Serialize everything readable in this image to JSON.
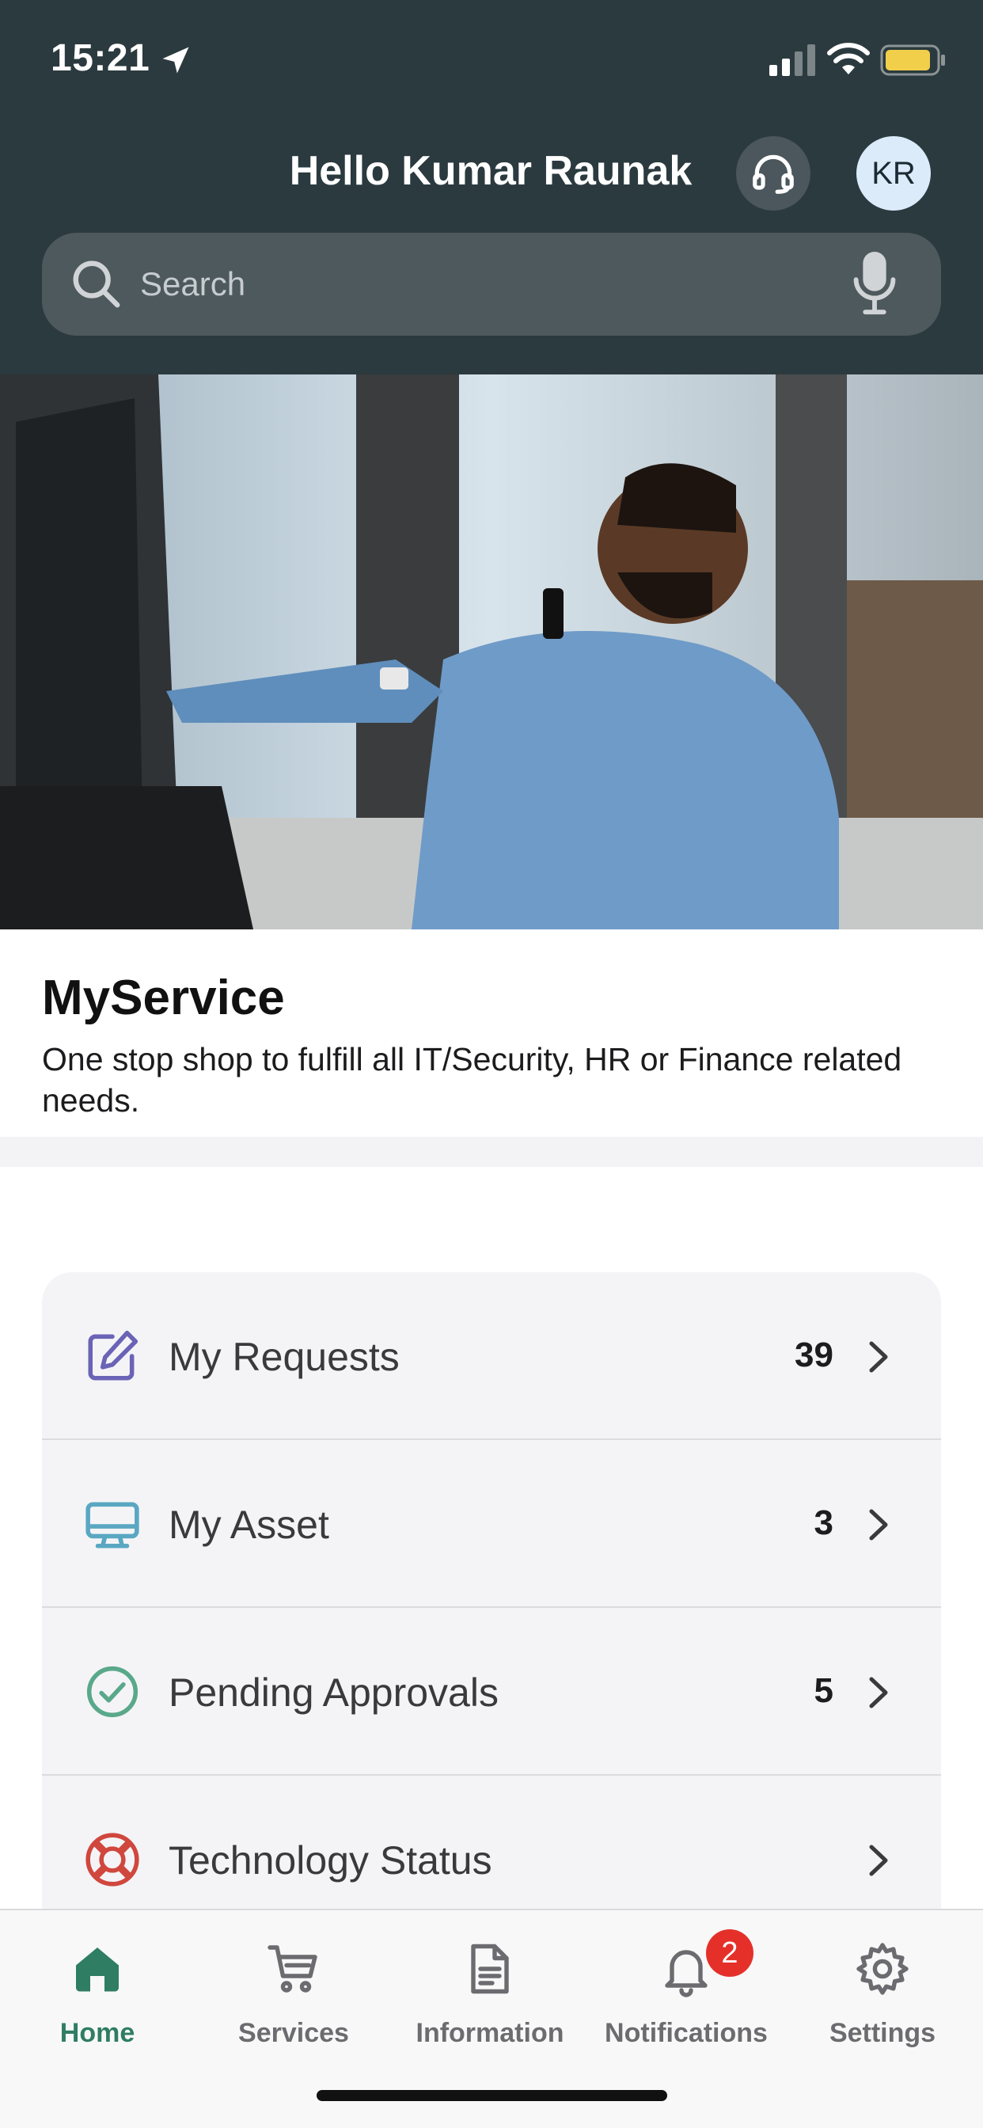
{
  "status_bar": {
    "time": "15:21"
  },
  "header": {
    "greeting": "Hello Kumar Raunak",
    "avatar_initials": "KR",
    "search": {
      "placeholder": "Search",
      "value": ""
    }
  },
  "intro": {
    "title": "MyService",
    "description": "One stop shop to fulfill all IT/Security, HR or Finance related needs."
  },
  "menu": {
    "items": [
      {
        "label": "My Requests",
        "count": "39",
        "icon": "edit-icon",
        "color": "#6b63b5"
      },
      {
        "label": "My Asset",
        "count": "3",
        "icon": "monitor-icon",
        "color": "#5aa7c2"
      },
      {
        "label": "Pending Approvals",
        "count": "5",
        "icon": "check-circle-icon",
        "color": "#5aa88a"
      },
      {
        "label": "Technology Status",
        "count": "",
        "icon": "lifebuoy-icon",
        "color": "#d0473d"
      }
    ]
  },
  "tabbar": {
    "items": [
      {
        "label": "Home",
        "icon": "home-icon",
        "active": true
      },
      {
        "label": "Services",
        "icon": "cart-icon",
        "active": false
      },
      {
        "label": "Information",
        "icon": "document-icon",
        "active": false
      },
      {
        "label": "Notifications",
        "icon": "bell-icon",
        "active": false,
        "badge": "2"
      },
      {
        "label": "Settings",
        "icon": "gear-icon",
        "active": false
      }
    ]
  },
  "colors": {
    "header_bg": "#2b3a3f",
    "accent": "#2f7d62",
    "badge": "#e5302a"
  }
}
